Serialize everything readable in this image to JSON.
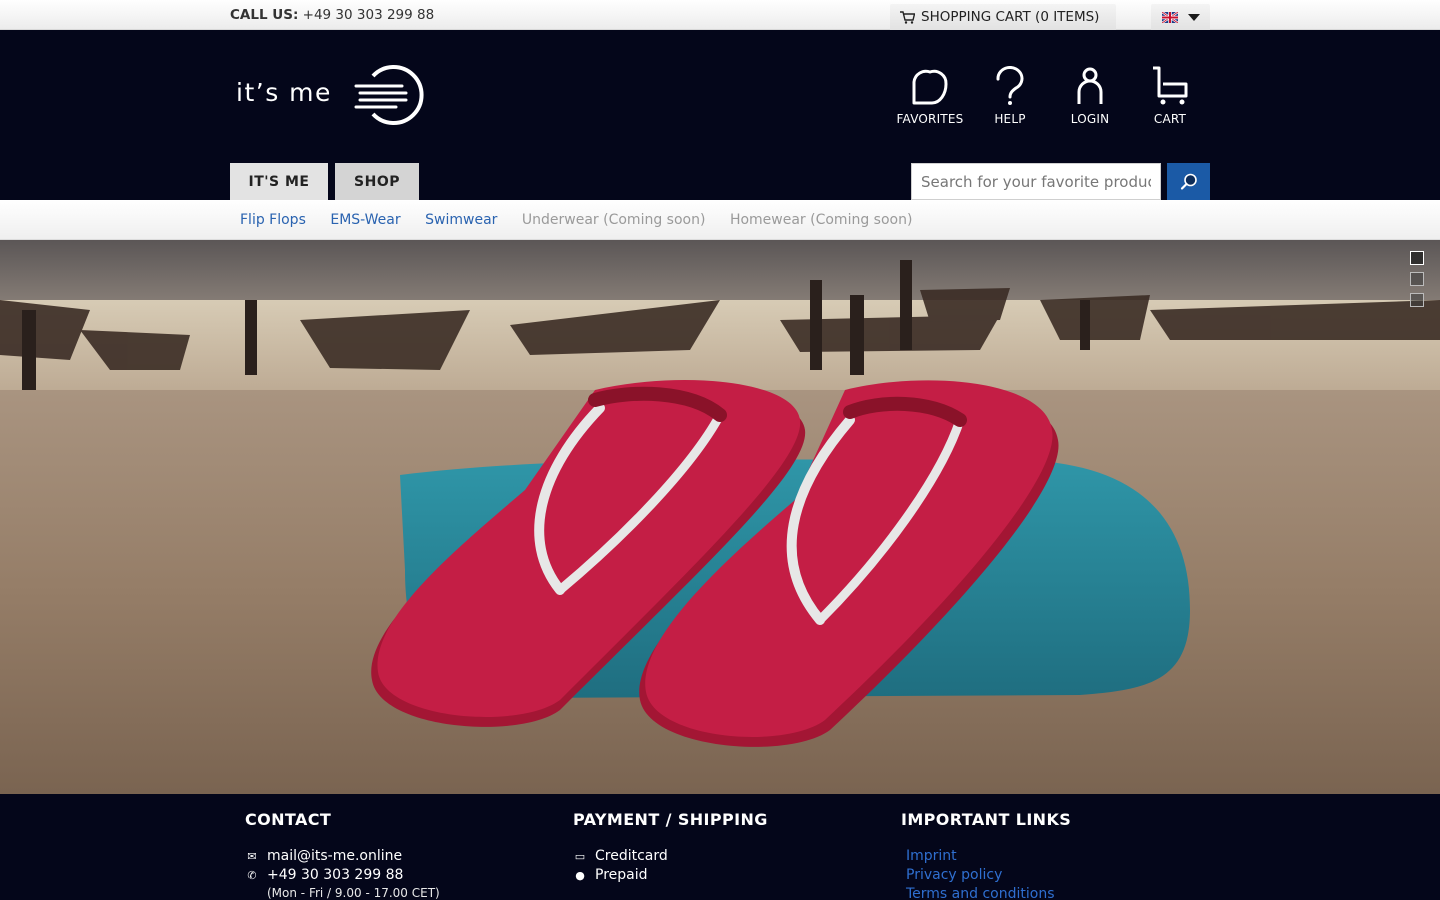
{
  "topbar": {
    "call_label": "CALL US:",
    "phone": "+49 30 303 299 88",
    "cart_label": "SHOPPING CART (0 ITEMS)"
  },
  "header": {
    "logo_text": "it's me",
    "icons": [
      {
        "name": "favorites",
        "label": "FAVORITES"
      },
      {
        "name": "help",
        "label": "HELP"
      },
      {
        "name": "login",
        "label": "LOGIN"
      },
      {
        "name": "cart",
        "label": "CART"
      }
    ],
    "tabs": [
      {
        "label": "IT'S ME"
      },
      {
        "label": "SHOP"
      }
    ],
    "search": {
      "placeholder": "Search for your favorite products..."
    }
  },
  "subnav": {
    "items": [
      {
        "label": "Flip Flops",
        "state": "active"
      },
      {
        "label": "EMS-Wear",
        "state": "active"
      },
      {
        "label": "Swimwear",
        "state": "active"
      },
      {
        "label": "Underwear (Coming soon)",
        "state": "disabled"
      },
      {
        "label": "Homewear (Coming soon)",
        "state": "disabled"
      }
    ]
  },
  "hero": {
    "slides_count": 3,
    "active_slide": 1
  },
  "footer": {
    "contact": {
      "title": "CONTACT",
      "email": "mail@its-me.online",
      "phone": "+49 30 303 299 88",
      "hours": "(Mon - Fri / 9.00 - 17.00 CET)"
    },
    "payment": {
      "title": "PAYMENT / SHIPPING",
      "methods": [
        "Creditcard",
        "Prepaid"
      ]
    },
    "links": {
      "title": "IMPORTANT LINKS",
      "items": [
        "Imprint",
        "Privacy policy",
        "Terms and conditions"
      ]
    }
  },
  "colors": {
    "header_bg": "#04061a",
    "accent_blue": "#1b5aa6",
    "link_blue": "#2a63b0",
    "flip_flop_red": "#c41e45"
  }
}
